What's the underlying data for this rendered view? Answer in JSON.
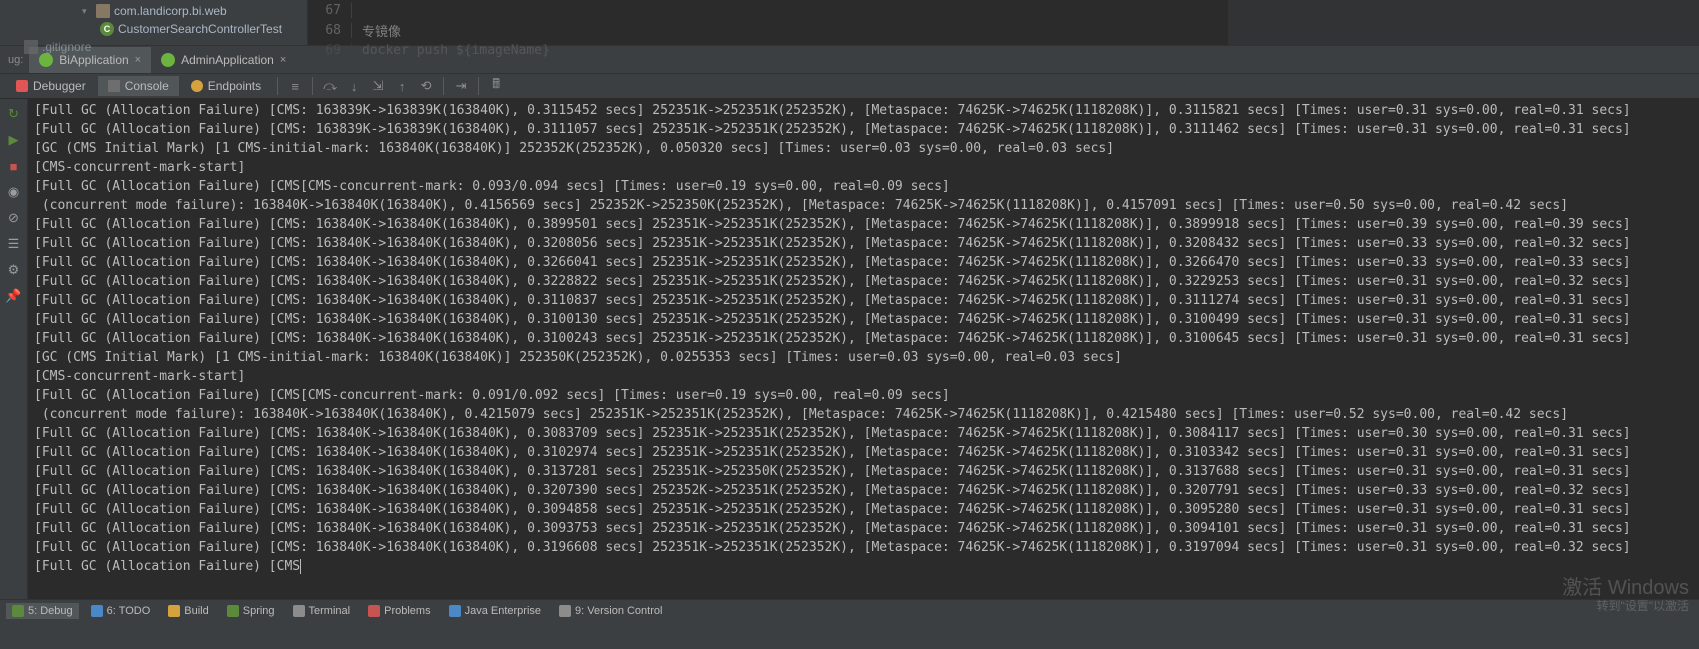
{
  "tree": {
    "pkg": "com.landicorp.bi.web",
    "cls": "CustomerSearchControllerTest",
    "gitignore": ".gitignore"
  },
  "editor": {
    "lines": [
      {
        "num": "67",
        "text": ""
      },
      {
        "num": "68",
        "text": "专镜像"
      },
      {
        "num": "69",
        "text": "docker push ${imageName}"
      }
    ]
  },
  "debug_label": "ug:",
  "run_configs": [
    {
      "name": "BiApplication",
      "active": true
    },
    {
      "name": "AdminApplication",
      "active": false
    }
  ],
  "panels": {
    "debugger": "Debugger",
    "console": "Console",
    "endpoints": "Endpoints"
  },
  "console_lines": [
    "[Full GC (Allocation Failure) [CMS: 163839K->163839K(163840K), 0.3115452 secs] 252351K->252351K(252352K), [Metaspace: 74625K->74625K(1118208K)], 0.3115821 secs] [Times: user=0.31 sys=0.00, real=0.31 secs]",
    "[Full GC (Allocation Failure) [CMS: 163839K->163839K(163840K), 0.3111057 secs] 252351K->252351K(252352K), [Metaspace: 74625K->74625K(1118208K)], 0.3111462 secs] [Times: user=0.31 sys=0.00, real=0.31 secs]",
    "[GC (CMS Initial Mark) [1 CMS-initial-mark: 163840K(163840K)] 252352K(252352K), 0.050320 secs] [Times: user=0.03 sys=0.00, real=0.03 secs]",
    "[CMS-concurrent-mark-start]",
    "[Full GC (Allocation Failure) [CMS[CMS-concurrent-mark: 0.093/0.094 secs] [Times: user=0.19 sys=0.00, real=0.09 secs]",
    " (concurrent mode failure): 163840K->163840K(163840K), 0.4156569 secs] 252352K->252350K(252352K), [Metaspace: 74625K->74625K(1118208K)], 0.4157091 secs] [Times: user=0.50 sys=0.00, real=0.42 secs]",
    "[Full GC (Allocation Failure) [CMS: 163840K->163840K(163840K), 0.3899501 secs] 252351K->252351K(252352K), [Metaspace: 74625K->74625K(1118208K)], 0.3899918 secs] [Times: user=0.39 sys=0.00, real=0.39 secs]",
    "[Full GC (Allocation Failure) [CMS: 163840K->163840K(163840K), 0.3208056 secs] 252351K->252351K(252352K), [Metaspace: 74625K->74625K(1118208K)], 0.3208432 secs] [Times: user=0.33 sys=0.00, real=0.32 secs]",
    "[Full GC (Allocation Failure) [CMS: 163840K->163840K(163840K), 0.3266041 secs] 252351K->252351K(252352K), [Metaspace: 74625K->74625K(1118208K)], 0.3266470 secs] [Times: user=0.33 sys=0.00, real=0.33 secs]",
    "[Full GC (Allocation Failure) [CMS: 163840K->163840K(163840K), 0.3228822 secs] 252351K->252351K(252352K), [Metaspace: 74625K->74625K(1118208K)], 0.3229253 secs] [Times: user=0.31 sys=0.00, real=0.32 secs]",
    "[Full GC (Allocation Failure) [CMS: 163840K->163840K(163840K), 0.3110837 secs] 252351K->252351K(252352K), [Metaspace: 74625K->74625K(1118208K)], 0.3111274 secs] [Times: user=0.31 sys=0.00, real=0.31 secs]",
    "[Full GC (Allocation Failure) [CMS: 163840K->163840K(163840K), 0.3100130 secs] 252351K->252351K(252352K), [Metaspace: 74625K->74625K(1118208K)], 0.3100499 secs] [Times: user=0.31 sys=0.00, real=0.31 secs]",
    "[Full GC (Allocation Failure) [CMS: 163840K->163840K(163840K), 0.3100243 secs] 252351K->252351K(252352K), [Metaspace: 74625K->74625K(1118208K)], 0.3100645 secs] [Times: user=0.31 sys=0.00, real=0.31 secs]",
    "[GC (CMS Initial Mark) [1 CMS-initial-mark: 163840K(163840K)] 252350K(252352K), 0.0255353 secs] [Times: user=0.03 sys=0.00, real=0.03 secs]",
    "[CMS-concurrent-mark-start]",
    "[Full GC (Allocation Failure) [CMS[CMS-concurrent-mark: 0.091/0.092 secs] [Times: user=0.19 sys=0.00, real=0.09 secs]",
    " (concurrent mode failure): 163840K->163840K(163840K), 0.4215079 secs] 252351K->252351K(252352K), [Metaspace: 74625K->74625K(1118208K)], 0.4215480 secs] [Times: user=0.52 sys=0.00, real=0.42 secs]",
    "[Full GC (Allocation Failure) [CMS: 163840K->163840K(163840K), 0.3083709 secs] 252351K->252351K(252352K), [Metaspace: 74625K->74625K(1118208K)], 0.3084117 secs] [Times: user=0.30 sys=0.00, real=0.31 secs]",
    "[Full GC (Allocation Failure) [CMS: 163840K->163840K(163840K), 0.3102974 secs] 252351K->252351K(252352K), [Metaspace: 74625K->74625K(1118208K)], 0.3103342 secs] [Times: user=0.31 sys=0.00, real=0.31 secs]",
    "[Full GC (Allocation Failure) [CMS: 163840K->163840K(163840K), 0.3137281 secs] 252351K->252350K(252352K), [Metaspace: 74625K->74625K(1118208K)], 0.3137688 secs] [Times: user=0.31 sys=0.00, real=0.31 secs]",
    "[Full GC (Allocation Failure) [CMS: 163840K->163840K(163840K), 0.3207390 secs] 252352K->252351K(252352K), [Metaspace: 74625K->74625K(1118208K)], 0.3207791 secs] [Times: user=0.33 sys=0.00, real=0.32 secs]",
    "[Full GC (Allocation Failure) [CMS: 163840K->163840K(163840K), 0.3094858 secs] 252351K->252351K(252352K), [Metaspace: 74625K->74625K(1118208K)], 0.3095280 secs] [Times: user=0.31 sys=0.00, real=0.31 secs]",
    "[Full GC (Allocation Failure) [CMS: 163840K->163840K(163840K), 0.3093753 secs] 252351K->252351K(252352K), [Metaspace: 74625K->74625K(1118208K)], 0.3094101 secs] [Times: user=0.31 sys=0.00, real=0.31 secs]",
    "[Full GC (Allocation Failure) [CMS: 163840K->163840K(163840K), 0.3196608 secs] 252351K->252351K(252352K), [Metaspace: 74625K->74625K(1118208K)], 0.3197094 secs] [Times: user=0.31 sys=0.00, real=0.32 secs]",
    "[Full GC (Allocation Failure) [CMS"
  ],
  "bottom": {
    "items": [
      {
        "name": "5: Debug",
        "icon": "green",
        "active": true
      },
      {
        "name": "6: TODO",
        "icon": "blue",
        "active": false
      },
      {
        "name": "Build",
        "icon": "orange",
        "active": false
      },
      {
        "name": "Spring",
        "icon": "green",
        "active": false
      },
      {
        "name": "Terminal",
        "icon": "gray",
        "active": false
      },
      {
        "name": "Problems",
        "icon": "red",
        "active": false
      },
      {
        "name": "Java Enterprise",
        "icon": "blue",
        "active": false
      },
      {
        "name": "9: Version Control",
        "icon": "gray",
        "active": false
      }
    ]
  },
  "watermark": {
    "line1": "激活 Windows",
    "line2": "转到\"设置\"以激活"
  }
}
